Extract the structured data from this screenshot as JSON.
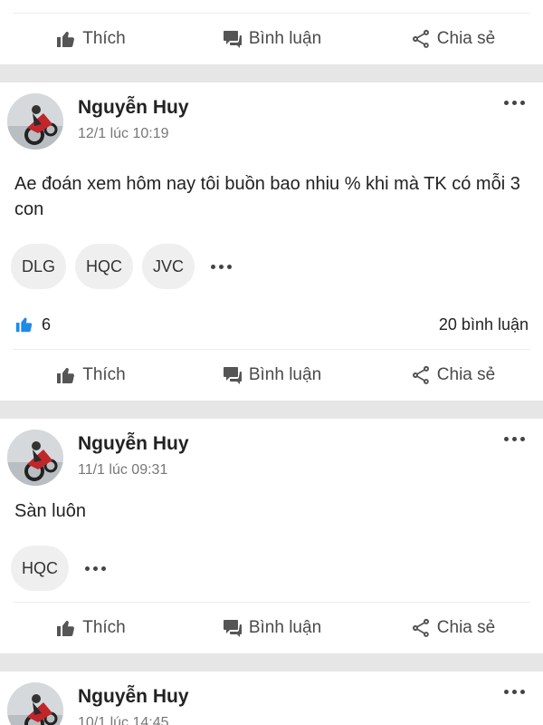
{
  "actions": {
    "like": "Thích",
    "comment": "Bình luận",
    "share": "Chia sẻ"
  },
  "posts": [
    {
      "author": "Nguyễn Huy",
      "time": "12/1 lúc 10:19",
      "text": "Ae đoán xem hôm nay tôi buồn bao nhiu % khi mà TK có mỗi 3 con",
      "tags": [
        "DLG",
        "HQC",
        "JVC"
      ],
      "likes": "6",
      "comments": "20 bình luận"
    },
    {
      "author": "Nguyễn Huy",
      "time": "11/1 lúc 09:31",
      "text": "Sàn luôn",
      "tags": [
        "HQC"
      ]
    },
    {
      "author": "Nguyễn Huy",
      "time": "10/1 lúc 14:45"
    }
  ]
}
